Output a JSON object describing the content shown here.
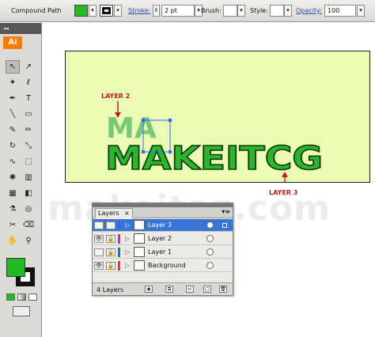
{
  "control_bar": {
    "object_type": "Compound Path",
    "fill_color": "#22bb22",
    "stroke_color": "#111111",
    "stroke_label": "Stroke:",
    "stroke_value": "2 pt",
    "brush_label": "Brush:",
    "style_label": "Style:",
    "opacity_label": "Opacity:",
    "opacity_value": "100"
  },
  "tools_panel": {
    "logo": "Ai",
    "collapse": "◂◂",
    "tools": [
      {
        "name": "selection-tool",
        "glyph": "↖",
        "active": true
      },
      {
        "name": "direct-selection-tool",
        "glyph": "↗",
        "active": false
      },
      {
        "name": "magic-wand-tool",
        "glyph": "✦",
        "active": false
      },
      {
        "name": "lasso-tool",
        "glyph": "ℓ",
        "active": false
      },
      {
        "name": "pen-tool",
        "glyph": "✒",
        "active": false
      },
      {
        "name": "type-tool",
        "glyph": "T",
        "active": false
      },
      {
        "name": "line-segment-tool",
        "glyph": "╲",
        "active": false
      },
      {
        "name": "rectangle-tool",
        "glyph": "▭",
        "active": false
      },
      {
        "name": "paintbrush-tool",
        "glyph": "✎",
        "active": false
      },
      {
        "name": "pencil-tool",
        "glyph": "✏",
        "active": false
      },
      {
        "name": "rotate-tool",
        "glyph": "↻",
        "active": false
      },
      {
        "name": "scale-tool",
        "glyph": "⤡",
        "active": false
      },
      {
        "name": "warp-tool",
        "glyph": "∿",
        "active": false
      },
      {
        "name": "free-transform-tool",
        "glyph": "⬚",
        "active": false
      },
      {
        "name": "symbol-sprayer-tool",
        "glyph": "✺",
        "active": false
      },
      {
        "name": "column-graph-tool",
        "glyph": "▥",
        "active": false
      },
      {
        "name": "mesh-tool",
        "glyph": "▦",
        "active": false
      },
      {
        "name": "gradient-tool",
        "glyph": "◧",
        "active": false
      },
      {
        "name": "eyedropper-tool",
        "glyph": "⚗",
        "active": false
      },
      {
        "name": "blend-tool",
        "glyph": "◎",
        "active": false
      },
      {
        "name": "slice-tool",
        "glyph": "✂",
        "active": false
      },
      {
        "name": "eraser-tool",
        "glyph": "⌫",
        "active": false
      },
      {
        "name": "hand-tool",
        "glyph": "✋",
        "active": false
      },
      {
        "name": "zoom-tool",
        "glyph": "⚲",
        "active": false
      }
    ],
    "fill_color": "#22bb22",
    "stroke_color": "#111111"
  },
  "canvas": {
    "artboard_color": "#ebfbb3",
    "artwork_text": "MAKEITCG",
    "artwork_fill": "#2db52d",
    "artwork_stroke": "#0d3d0d",
    "ghost_letters": "MA",
    "ghost_fill": "#78c878",
    "annotation_color": "#c41a24",
    "label_layer2": "LAYER 2",
    "label_layer3": "LAYER 3",
    "watermark": "makeitcg.com"
  },
  "layers_panel": {
    "tab": "Layers",
    "close": "×",
    "menu": "▾≡",
    "rows": [
      {
        "name": "Layer 3",
        "color": "#3366ff",
        "selected": true,
        "visible": true,
        "locked": false
      },
      {
        "name": "Layer 2",
        "color": "#cc3399",
        "selected": false,
        "visible": true,
        "locked": true
      },
      {
        "name": "Layer 1",
        "color": "#3366cc",
        "selected": false,
        "visible": false,
        "locked": true
      },
      {
        "name": "Background",
        "color": "#dd3344",
        "selected": false,
        "visible": true,
        "locked": true
      }
    ],
    "count": "4 Layers"
  }
}
